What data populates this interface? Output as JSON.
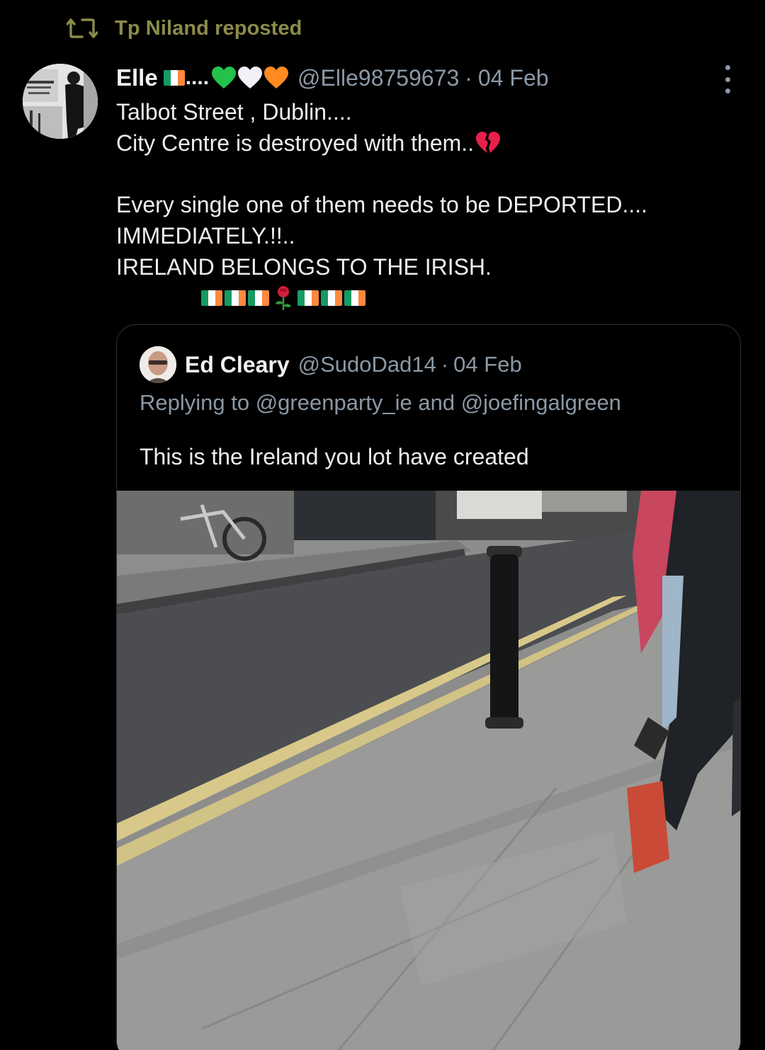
{
  "repost": {
    "icon": "repost-icon",
    "text": "Tp Niland reposted"
  },
  "post": {
    "display_name": "Elle",
    "name_dots": "....",
    "handle": "@Elle98759673",
    "separator": "·",
    "date": "04 Feb",
    "lines": [
      "Talbot Street , Dublin....",
      "City Centre is destroyed with them..",
      "Every single one of them needs to be DEPORTED....",
      "IMMEDIATELY.!!..",
      "IRELAND BELONGS TO THE IRISH."
    ],
    "emoji": {
      "name_decor": [
        "ireland-flag",
        "green-heart",
        "white-heart",
        "orange-heart"
      ],
      "after_line_2": "broken-heart",
      "flag_row": [
        "ireland-flag",
        "ireland-flag",
        "ireland-flag",
        "rose",
        "ireland-flag",
        "ireland-flag",
        "ireland-flag"
      ]
    }
  },
  "quote": {
    "display_name": "Ed Cleary",
    "handle": "@SudoDad14",
    "separator": "·",
    "date": "04 Feb",
    "replying_to": "Replying to @greenparty_ie and @joefingalgreen",
    "text": "This is the Ireland you lot have created"
  },
  "colors": {
    "background": "#000000",
    "text_primary": "#e7e9ea",
    "text_secondary": "#8b98a5",
    "repost_accent": "#8b8b4a",
    "border": "#2f3336"
  }
}
